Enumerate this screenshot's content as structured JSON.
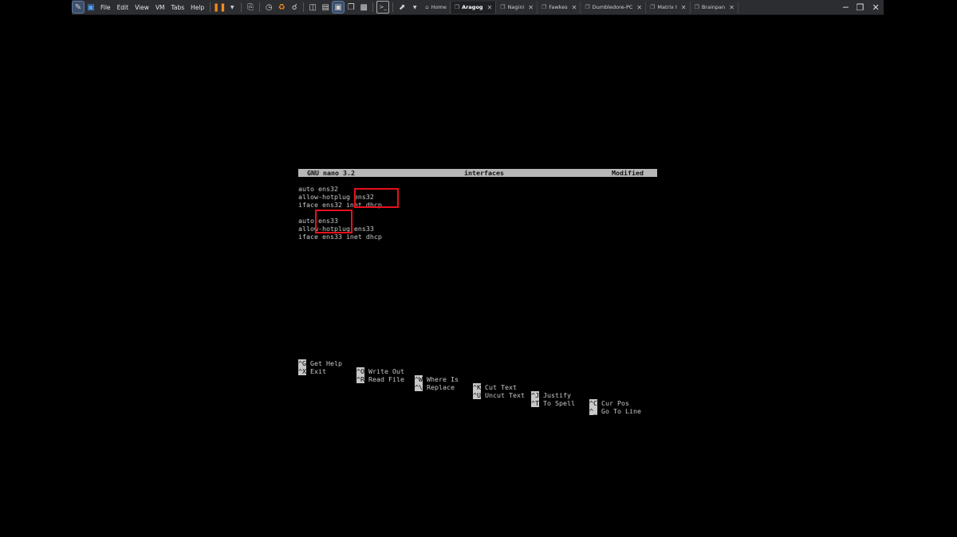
{
  "toolbar": {
    "menus": [
      "File",
      "Edit",
      "View",
      "VM",
      "Tabs",
      "Help"
    ],
    "tabs": [
      {
        "label": "Home",
        "active": false
      },
      {
        "label": "Aragog",
        "active": true
      },
      {
        "label": "Nagini",
        "active": false
      },
      {
        "label": "Fawkes",
        "active": false
      },
      {
        "label": "Dumbledore-PC",
        "active": false
      },
      {
        "label": "Matrix I",
        "active": false
      },
      {
        "label": "Brainpan",
        "active": false
      }
    ]
  },
  "nano": {
    "version": "GNU nano 3.2",
    "filename": "interfaces",
    "status": "Modified",
    "lines": [
      "auto ens32",
      "allow-hotplug ens32",
      "iface ens32 inet dhcp",
      "",
      "auto ens33",
      "allow-hotplug ens33",
      "iface ens33 inet dhcp"
    ],
    "shortcuts_row1": [
      {
        "key": "^G",
        "label": "Get Help"
      },
      {
        "key": "^O",
        "label": "Write Out"
      },
      {
        "key": "^W",
        "label": "Where Is"
      },
      {
        "key": "^K",
        "label": "Cut Text"
      },
      {
        "key": "^J",
        "label": "Justify"
      },
      {
        "key": "^C",
        "label": "Cur Pos"
      }
    ],
    "shortcuts_row2": [
      {
        "key": "^X",
        "label": "Exit"
      },
      {
        "key": "^R",
        "label": "Read File"
      },
      {
        "key": "^\\",
        "label": "Replace"
      },
      {
        "key": "^U",
        "label": "Uncut Text"
      },
      {
        "key": "^T",
        "label": "To Spell"
      },
      {
        "key": "^_",
        "label": "Go To Line"
      }
    ]
  },
  "colors": {
    "highlight_box": "#e8101c",
    "toolbar_bg": "#2b2d31",
    "terminal_bg": "#000000"
  }
}
